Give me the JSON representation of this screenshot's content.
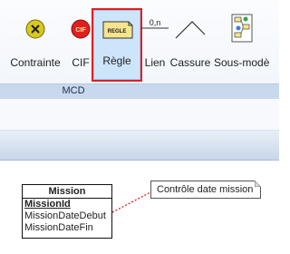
{
  "ribbon": {
    "tools": {
      "contrainte": {
        "label": "Contrainte",
        "icon": "constraint-x-icon",
        "color": "#d8c81e"
      },
      "cif": {
        "label": "CIF",
        "icon": "cif-icon",
        "color": "#e0201e"
      },
      "regle": {
        "label": "Règle",
        "icon": "rule-icon",
        "icon_text": "REGLE",
        "color": "#f6e58d",
        "selected": true
      },
      "lien": {
        "label": "Lien",
        "icon": "link-cardinality-icon",
        "icon_text": "0,n"
      },
      "cassure": {
        "label": "Cassure",
        "icon": "break-line-icon"
      },
      "sousmodele": {
        "label": "Sous-modè",
        "icon": "submodel-icon"
      }
    },
    "group_label": "MCD",
    "highlight_color": "#e0201e"
  },
  "diagram": {
    "entity": {
      "title": "Mission",
      "attributes": [
        {
          "name": "MissionId",
          "key": true
        },
        {
          "name": "MissionDateDebut",
          "key": false
        },
        {
          "name": "MissionDateFin",
          "key": false
        }
      ]
    },
    "note": {
      "text": "Contrôle date mission"
    },
    "link_color": "#e0201e"
  }
}
